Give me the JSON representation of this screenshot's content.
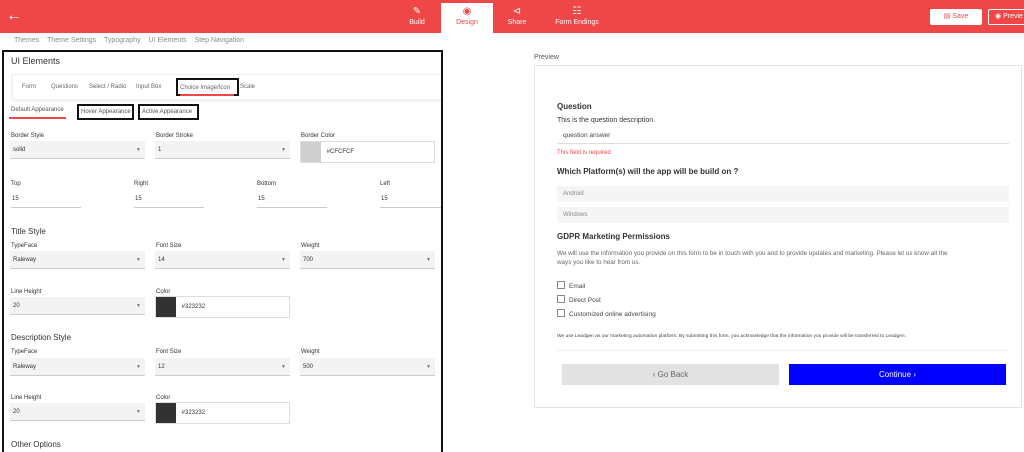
{
  "topbar": {
    "back_icon": "arrow-left-icon",
    "nav": [
      {
        "label": "Build",
        "icon": "pencil-icon"
      },
      {
        "label": "Design",
        "icon": "palette-icon"
      },
      {
        "label": "Share",
        "icon": "share-icon"
      },
      {
        "label": "Form Endings",
        "icon": "flow-icon"
      }
    ],
    "save_label": "Save",
    "preview_label": "Previe",
    "brand_color": "#ef4747"
  },
  "subnav": [
    "Themes",
    "Theme Settings",
    "Typography",
    "UI Elements",
    "Step Navigation"
  ],
  "left": {
    "title": "UI Elements",
    "tabs": [
      "Form",
      "Questions",
      "Select / Radio",
      "Input Box",
      "Choice Image/Icon",
      "Scale"
    ],
    "subtabs": [
      "Default Appearance",
      "Hover Appearance",
      "Active Appearance"
    ],
    "border": {
      "style_label": "Border Style",
      "style_value": "solid",
      "stroke_label": "Border Stroke",
      "stroke_value": "1",
      "color_label": "Border Color",
      "color_value": "#CFCFCF"
    },
    "spacing": {
      "top_label": "Top",
      "top_value": "15",
      "right_label": "Right",
      "right_value": "15",
      "bottom_label": "Bottom",
      "bottom_value": "15",
      "left_label": "Left",
      "left_value": "15"
    },
    "title_style": {
      "heading": "Title Style",
      "typeface_label": "TypeFace",
      "typeface_value": "Raleway",
      "fontsize_label": "Font Size",
      "fontsize_value": "14",
      "weight_label": "Weight",
      "weight_value": "700",
      "lineheight_label": "Line Height",
      "lineheight_value": "20",
      "color_label": "Color",
      "color_value": "#323232"
    },
    "description_style": {
      "heading": "Description Style",
      "typeface_label": "TypeFace",
      "typeface_value": "Raleway",
      "fontsize_label": "Font Size",
      "fontsize_value": "12",
      "weight_label": "Weight",
      "weight_value": "500",
      "lineheight_label": "Line Height",
      "lineheight_value": "20",
      "color_label": "Color",
      "color_value": "#323232"
    },
    "other_options": "Other Options"
  },
  "preview": {
    "label": "Preview",
    "question_title": "Question",
    "question_desc": "This is the question description.",
    "question_answer": "question answer",
    "error": "This field is required",
    "platform_question": "Which Platform(s) will the app will be build on ?",
    "options": [
      "Android",
      "Windows"
    ],
    "gdpr_title": "GDPR Marketing Permissions",
    "gdpr_text_1": "We will use the information you provide on this form to be in touch with you and to provide updates and marketing. Please let us know all the",
    "gdpr_text_2": "ways you like to hear from us.",
    "checkboxes": [
      "Email",
      "Direct Post",
      "Customized online advertising"
    ],
    "footer_note": "We use Leadgen as our marketing automation platform. By submitting this form, you acknowledge that the information you provide will be transferred to Leadgen.",
    "back_label": "Go Back",
    "continue_label": "Continue",
    "continue_color": "#0000ff"
  }
}
